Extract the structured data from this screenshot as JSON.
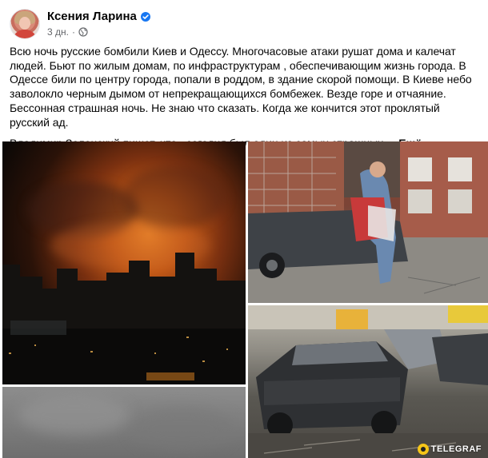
{
  "post": {
    "author": {
      "name": "Ксения Ларина",
      "verified_icon": "verified-badge-icon",
      "avatar_icon": "profile-avatar"
    },
    "time": "3 дн.",
    "separator": "·",
    "audience_icon": "globe-icon",
    "paragraphs": [
      "Всю ночь русские бомбили Киев и Одессу. Многочасовые атаки рушат дома и калечат людей. Бьют по жилым домам, по инфраструктурам , обеспечивающим жизнь города. В Одессе били по центру города, попали в  роддом, в здание скорой  помощи. В Киеве небо заволокло черным дымом от непрекращающихся бомбежек. Везде горе и отчаяние. Бессонная страшная ночь. Не знаю что сказать. Когда же кончится этот проклятый русский ад.",
      "Владимир Зеленский пишет, что «сегодня был один из самых страшных ..."
    ],
    "more_label": "Ещё",
    "photos": [
      {
        "name": "photo-kyiv-night-fire"
      },
      {
        "name": "photo-woman-with-clothes"
      },
      {
        "name": "photo-destroyed-cars"
      },
      {
        "name": "photo-grey-smoke-sky"
      }
    ],
    "watermark": "TELEGRAF"
  },
  "colors": {
    "text": "#050505",
    "secondary_text": "#65676b",
    "verified_blue": "#1877f2",
    "fire_orange": "#f08a2a"
  }
}
